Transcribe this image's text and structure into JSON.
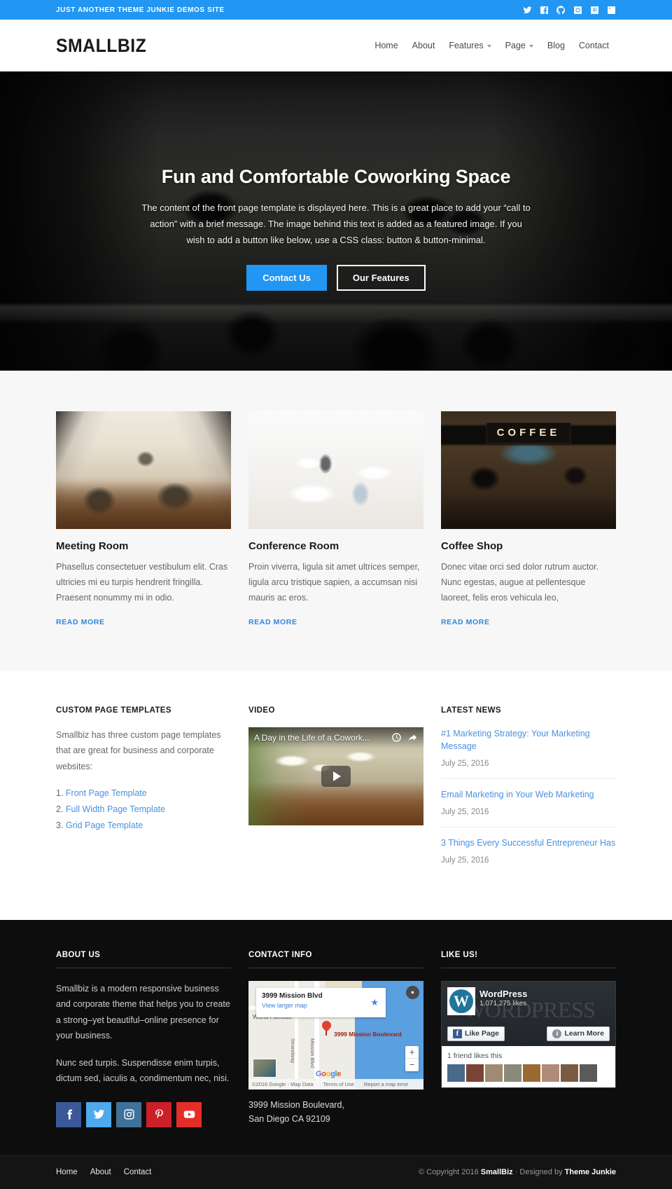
{
  "topbar": {
    "tagline": "Just Another Theme Junkie Demos Site",
    "social": [
      {
        "name": "twitter",
        "icon": "twitter-icon"
      },
      {
        "name": "facebook",
        "icon": "facebook-icon"
      },
      {
        "name": "github",
        "icon": "github-icon"
      },
      {
        "name": "instagram",
        "icon": "instagram-icon"
      },
      {
        "name": "pinterest",
        "icon": "pinterest-icon"
      },
      {
        "name": "linkedin",
        "icon": "linkedin-icon"
      }
    ]
  },
  "header": {
    "logo": "SmallBiz",
    "nav": [
      {
        "label": "Home",
        "dropdown": false
      },
      {
        "label": "About",
        "dropdown": false
      },
      {
        "label": "Features",
        "dropdown": true
      },
      {
        "label": "Page",
        "dropdown": true
      },
      {
        "label": "Blog",
        "dropdown": false
      },
      {
        "label": "Contact",
        "dropdown": false
      }
    ]
  },
  "hero": {
    "title": "Fun and Comfortable Coworking Space",
    "description": "The content of the front page template is displayed here. This is a great place to add your “call to action” with a brief message. The image behind this text is added as a featured image. If you wish to add a button like below, use a CSS class: button & button-minimal.",
    "primary_button": "Contact Us",
    "secondary_button": "Our Features"
  },
  "features": {
    "read_more": "Read More",
    "cards": [
      {
        "title": "Meeting Room",
        "text": "Phasellus consectetuer vestibulum elit. Cras ultricies mi eu turpis hendrerit fringilla. Praesent nonummy mi in odio.",
        "image": "meeting-room-photo"
      },
      {
        "title": "Conference Room",
        "text": "Proin viverra, ligula sit amet ultrices semper, ligula arcu tristique sapien, a accumsan nisi mauris ac eros.",
        "image": "conference-room-photo"
      },
      {
        "title": "Coffee Shop",
        "text": "Donec vitae orci sed dolor rutrum auctor. Nunc egestas, augue at pellentesque laoreet, felis eros vehicula leo,",
        "image": "coffee-shop-photo",
        "sign_text": "COFFEE"
      }
    ]
  },
  "mid": {
    "templates": {
      "heading": "Custom Page Templates",
      "text": "Smallbiz has three custom page templates that are great for business and corporate websites:",
      "items": [
        "Front Page Template",
        "Full Width Page Template",
        "Grid Page Template"
      ]
    },
    "video": {
      "heading": "Video",
      "title": "A Day in the Life of a Cowork...",
      "watch_later_icon": "clock-icon",
      "share_icon": "share-icon",
      "play_icon": "play-icon"
    },
    "news": {
      "heading": "Latest News",
      "items": [
        {
          "title": "#1 Marketing Strategy: Your Marketing Message",
          "date": "July 25, 2016"
        },
        {
          "title": "Email Marketing in Your Web Marketing",
          "date": "July 25, 2016"
        },
        {
          "title": "3 Things Every Successful Entrepreneur Has",
          "date": "July 25, 2016"
        }
      ]
    }
  },
  "footer": {
    "about": {
      "heading": "About Us",
      "paragraph1": "Smallbiz is a modern responsive business and corporate theme that helps you to create a strong–yet beautiful–online presence for your business.",
      "paragraph2": "Nunc sed turpis. Suspendisse enim turpis, dictum sed, iaculis a, condimentum nec, nisi.",
      "social": [
        {
          "name": "facebook",
          "icon": "facebook-icon",
          "color": "#3b5998"
        },
        {
          "name": "twitter",
          "icon": "twitter-icon",
          "color": "#4eaaea"
        },
        {
          "name": "instagram",
          "icon": "instagram-icon",
          "color": "#3f729b"
        },
        {
          "name": "pinterest",
          "icon": "pinterest-icon",
          "color": "#cb2027"
        },
        {
          "name": "youtube",
          "icon": "youtube-icon",
          "color": "#e52d27"
        }
      ]
    },
    "contact": {
      "heading": "Contact Info",
      "map": {
        "card_title": "3999 Mission Blvd",
        "card_link": "View larger map",
        "marker_label": "3999 Mission Boulevard",
        "poi_label": "World Famous",
        "street1": "Strandway",
        "street2": "Mission Blvd",
        "google_letters": [
          "G",
          "o",
          "o",
          "g",
          "l",
          "e"
        ],
        "credit": "©2016 Google - Map Data",
        "terms": "Terms of Use",
        "report": "Report a map error",
        "zoom_in": "+",
        "zoom_out": "−"
      },
      "address_line1": "3999 Mission Boulevard,",
      "address_line2": "San Diego CA 92109"
    },
    "like": {
      "heading": "Like Us!",
      "page_name": "WordPress",
      "likes": "1,071,275 likes",
      "watermark": "WORDPRESS",
      "like_button": "Like Page",
      "learn_button": "Learn More",
      "friends_label": "1 friend likes this",
      "face_colors": [
        "#4a6a8a",
        "#7a4434",
        "#a08a74",
        "#8a8a7a",
        "#9a6a30",
        "#b08a78",
        "#7a5a40",
        "#5a5a58"
      ]
    }
  },
  "bottombar": {
    "nav": [
      "Home",
      "About",
      "Contact"
    ],
    "copyright_pre": "© Copyright 2016 ",
    "copyright_brand": "SmallBiz",
    "copyright_mid": " · Designed by ",
    "copyright_designer": "Theme Junkie"
  }
}
